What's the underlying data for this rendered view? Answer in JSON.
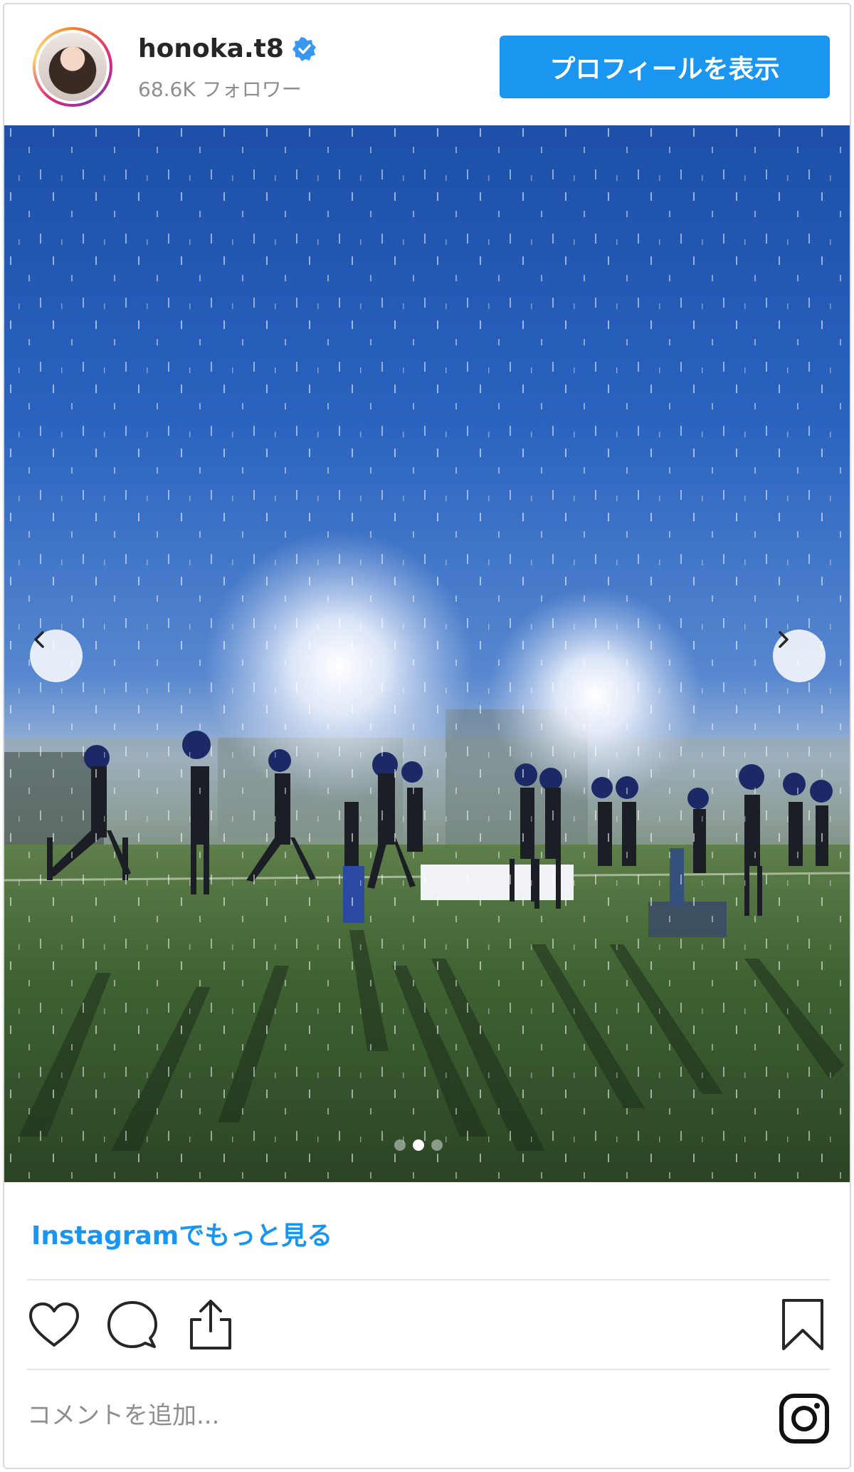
{
  "header": {
    "username": "honoka.t8",
    "verified": true,
    "followers": "68.6K フォロワー",
    "view_profile_label": "プロフィールを表示"
  },
  "post": {
    "carousel": {
      "total": 3,
      "active_index": 1
    },
    "more_link": "Instagramでもっと見る"
  },
  "comment": {
    "placeholder": "コメントを追加..."
  },
  "icons": {
    "verified": "verified-badge-icon",
    "prev": "chevron-left-icon",
    "next": "chevron-right-icon",
    "like": "heart-icon",
    "comment": "comment-bubble-icon",
    "share": "share-icon",
    "save": "bookmark-icon",
    "brand": "instagram-icon"
  },
  "colors": {
    "accent": "#1a95f0",
    "verified": "#3897f0",
    "muted": "#8e8e8e"
  }
}
